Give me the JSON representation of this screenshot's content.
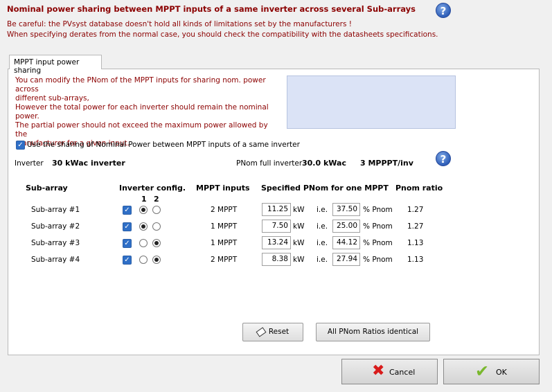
{
  "dialog": {
    "title": "Nominal power sharing between MPPT inputs of a same inverter across several Sub-arrays",
    "warning_line1": "Be careful: the PVsyst database doesn't hold all kinds of limitations set by the manufacturers !",
    "warning_line2": "When specifying derates from the normal case, you should check the compatibility with the datasheets specifications."
  },
  "tab": {
    "label": "MPPT input power sharing"
  },
  "info": {
    "line1": "You can modify the PNom of the MPPT inputs for sharing nom. power across",
    "line2": "different sub-arrays,",
    "line3": "However the total power for each inverter should remain the nominal power.",
    "line4": "The partial power should not exceed the maximum power allowed by the",
    "line5": "manufacturer for a given input."
  },
  "use_sharing": {
    "label": "Use the sharing of Nominal Power between MPPT inputs of a same inverter",
    "checked": true,
    "check_glyph": "✓"
  },
  "inverter": {
    "label": "Inverter",
    "name": "30 kWac inverter",
    "pnom_label": "PNom full inverter",
    "pnom_value": "30.0 kWac",
    "mppt_per_inv": "3 MPPPT/inv"
  },
  "table": {
    "headers": {
      "subarray": "Sub-array",
      "config": "Inverter config.",
      "config_1": "1",
      "config_2": "2",
      "mppt": "MPPT inputs",
      "pnom": "Specified PNom for one MPPT",
      "ratio": "Pnom ratio"
    },
    "rows": [
      {
        "name": "Sub-array #1",
        "checked": true,
        "config_selected": 1,
        "mppt": "2 MPPT",
        "kw": "11.25",
        "kw_unit": "kW",
        "ie": "i.e.",
        "pct": "37.50",
        "pct_unit": "% Pnom",
        "ratio": "1.27"
      },
      {
        "name": "Sub-array #2",
        "checked": true,
        "config_selected": 1,
        "mppt": "1 MPPT",
        "kw": "7.50",
        "kw_unit": "kW",
        "ie": "i.e.",
        "pct": "25.00",
        "pct_unit": "% Pnom",
        "ratio": "1.27"
      },
      {
        "name": "Sub-array #3",
        "checked": true,
        "config_selected": 2,
        "mppt": "1 MPPT",
        "kw": "13.24",
        "kw_unit": "kW",
        "ie": "i.e.",
        "pct": "44.12",
        "pct_unit": "% Pnom",
        "ratio": "1.13"
      },
      {
        "name": "Sub-array #4",
        "checked": true,
        "config_selected": 2,
        "mppt": "2 MPPT",
        "kw": "8.38",
        "kw_unit": "kW",
        "ie": "i.e.",
        "pct": "27.94",
        "pct_unit": "% Pnom",
        "ratio": "1.13"
      }
    ]
  },
  "buttons": {
    "reset": "Reset",
    "identical": "All PNom Ratios identical",
    "cancel": "Cancel",
    "ok": "OK"
  },
  "icons": {
    "help": "?",
    "help_icon": "help-icon",
    "eraser_icon": "eraser-icon",
    "cancel_icon": "red-x-icon",
    "ok_icon": "green-check-icon"
  },
  "colors": {
    "title": "#8b0000",
    "accent": "#2f6fc7",
    "info_box": "#dbe3f6"
  }
}
